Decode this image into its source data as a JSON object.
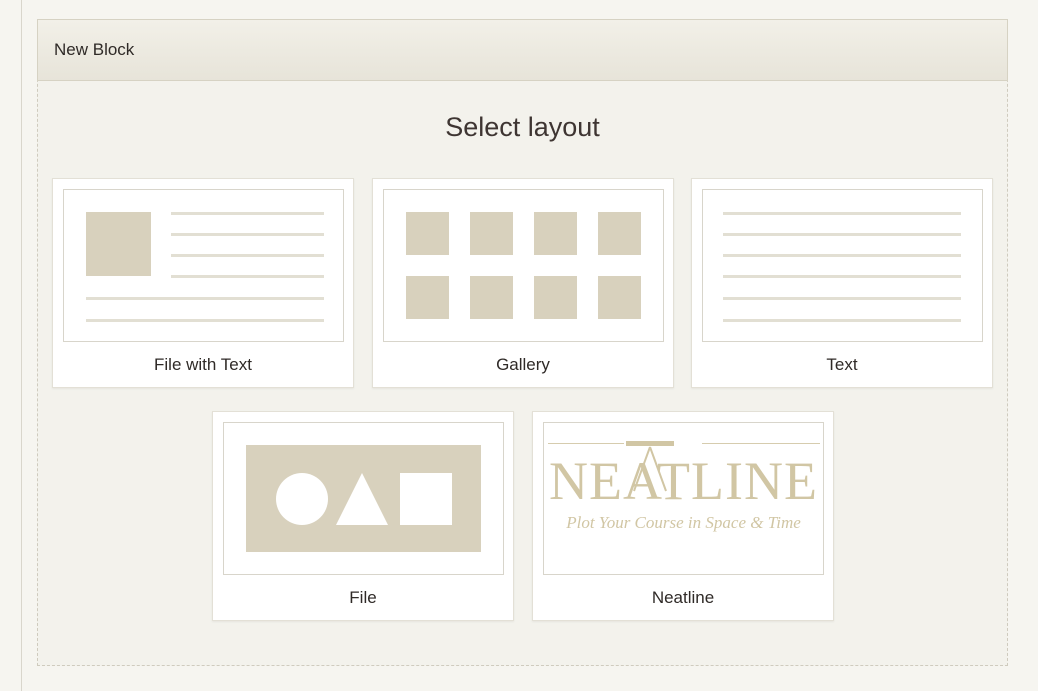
{
  "panel": {
    "title": "New Block",
    "heading": "Select layout"
  },
  "layouts": [
    {
      "label": "File with Text"
    },
    {
      "label": "Gallery"
    },
    {
      "label": "Text"
    },
    {
      "label": "File"
    },
    {
      "label": "Neatline"
    }
  ],
  "neatline_logo": {
    "word": "NEATLINE",
    "tagline": "Plot Your Course in Space & Time"
  },
  "colors": {
    "placeholder_fill": "#d8d1bd",
    "placeholder_line": "#e2dfd3",
    "header_bg": "#ece9df"
  }
}
